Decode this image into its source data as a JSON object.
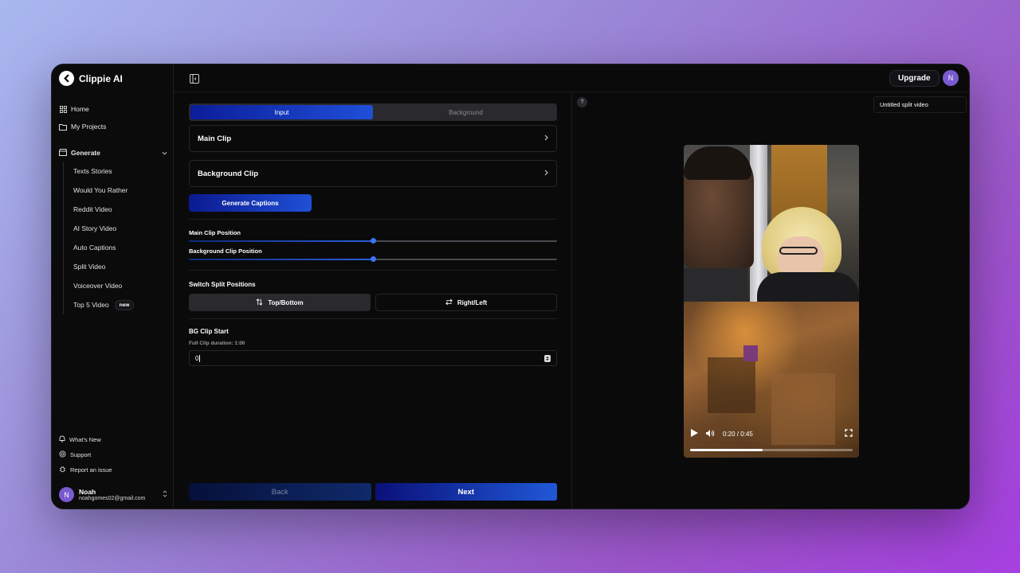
{
  "brand": {
    "name": "Clippie AI"
  },
  "nav": {
    "home": "Home",
    "projects": "My Projects",
    "generate": "Generate",
    "sub_items": [
      {
        "label": "Texts Stories"
      },
      {
        "label": "Would You Rather"
      },
      {
        "label": "Reddit Video"
      },
      {
        "label": "AI Story Video"
      },
      {
        "label": "Auto Captions"
      },
      {
        "label": "Split Video"
      },
      {
        "label": "Voiceover Video"
      },
      {
        "label": "Top 5 Video",
        "badge": "new"
      }
    ]
  },
  "footer_links": {
    "whats_new": "What's New",
    "support": "Support",
    "report": "Report an issue"
  },
  "user": {
    "initial": "N",
    "name": "Noah",
    "email": "noahgomes02@gmail.com"
  },
  "topbar": {
    "upgrade": "Upgrade",
    "avatar_initial": "N"
  },
  "form": {
    "tabs": {
      "input": "Input",
      "background": "Background",
      "active": "input"
    },
    "main_clip": "Main Clip",
    "background_clip": "Background Clip",
    "generate_captions": "Generate Captions",
    "main_clip_position": {
      "label": "Main Clip Position",
      "value": 0.5
    },
    "background_clip_position": {
      "label": "Background Clip Position",
      "value": 0.5
    },
    "switch_label": "Switch Split Positions",
    "switch_options": {
      "top_bottom": "Top/Bottom",
      "right_left": "Right/Left",
      "active": "top_bottom"
    },
    "bg_clip_start": {
      "label": "BG Clip Start",
      "duration": "Full Clip duration: 1:00",
      "value": "0"
    }
  },
  "buttons": {
    "back": "Back",
    "next": "Next"
  },
  "preview": {
    "help": "?",
    "title": "Untitled split video",
    "time": "0:20 / 0:45",
    "progress": 0.444
  },
  "colors": {
    "accent": "#1f4fd8",
    "avatar": "#7a5ad0"
  }
}
